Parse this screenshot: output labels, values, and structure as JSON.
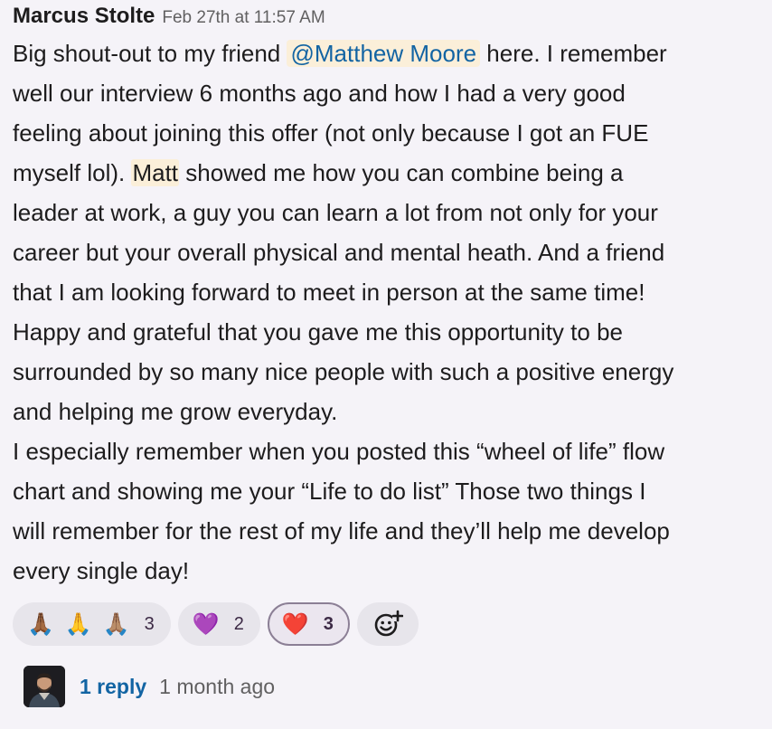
{
  "message": {
    "author": "Marcus Stolte",
    "timestamp": "Feb 27th at 11:57 AM",
    "lines": [
      {
        "before": "Big shout-out to my friend ",
        "mention": "@Matthew Moore",
        "after": " here. I remember"
      },
      {
        "text": "well our interview 6 months ago and how I had a very good"
      },
      {
        "text": "feeling about joining this offer (not only because I got an FUE"
      },
      {
        "before": "myself lol). ",
        "highlight": "Matt",
        "after": " showed me how you can combine being a"
      },
      {
        "text": "leader at work, a guy you can learn a lot from not only for your"
      },
      {
        "text": "career but your overall physical and mental heath. And a friend"
      },
      {
        "text": "that I am looking forward to meet in person at the same time!"
      },
      {
        "text": "Happy and grateful that you gave me this opportunity to be"
      },
      {
        "text": "surrounded by so many nice people with such a positive energy"
      },
      {
        "text": "and helping me grow everyday."
      },
      {
        "text": "I especially remember when you posted this “wheel of life” flow"
      },
      {
        "text": "chart and showing me your “Life to do list” Those two things I"
      },
      {
        "text": "will remember for the rest of my life and they’ll help me develop"
      },
      {
        "text": "every single day!"
      }
    ]
  },
  "reactions": [
    {
      "emoji": [
        "🙏🏾",
        "🙏",
        "🙏🏽"
      ],
      "emoji_names": [
        "folded-hands-dark-icon",
        "folded-hands-icon",
        "folded-hands-medium-icon"
      ],
      "count": "3",
      "active": false
    },
    {
      "emoji": [
        "💜"
      ],
      "emoji_names": [
        "purple-heart-icon"
      ],
      "count": "2",
      "active": false
    },
    {
      "emoji": [
        "❤️"
      ],
      "emoji_names": [
        "red-heart-icon"
      ],
      "count": "3",
      "active": true
    }
  ],
  "add_reaction_icon": "add-emoji-icon",
  "thread": {
    "reply_count": "1 reply",
    "reply_time": "1 month ago",
    "avatar_icon": "user-avatar"
  },
  "colors": {
    "background": "#f5f3f8",
    "link": "#1264a3",
    "mention_bg": "#fbefd9",
    "active_reaction_border": "#8b7f95"
  }
}
